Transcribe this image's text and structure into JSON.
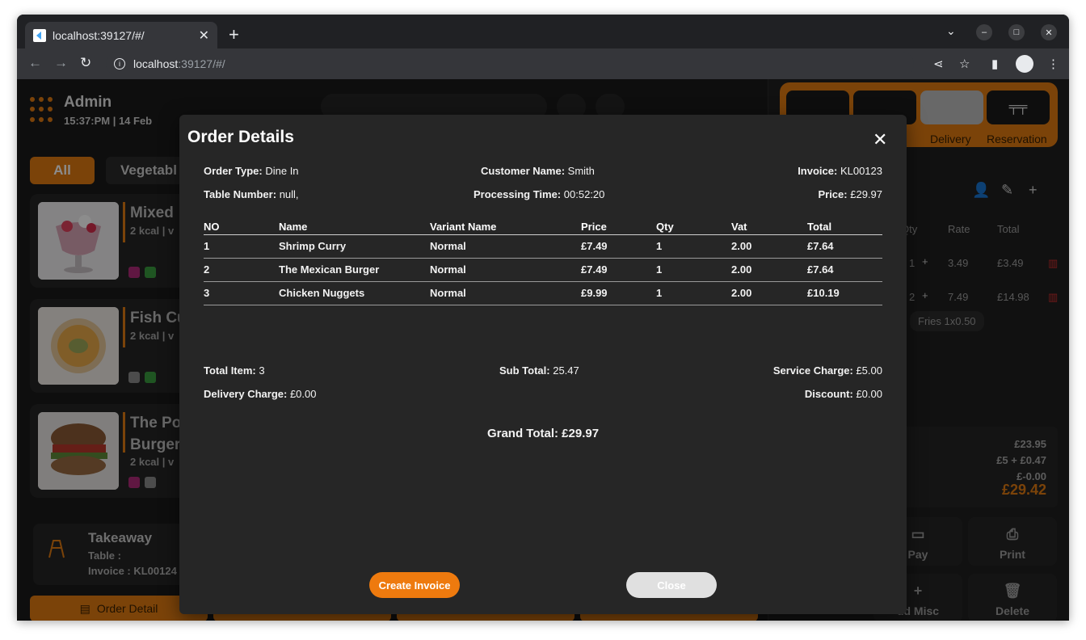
{
  "browser": {
    "tab_title": "localhost:39127/#/",
    "url_host": "localhost",
    "url_rest": ":39127/#/"
  },
  "header": {
    "user_name": "Admin",
    "datetime": "15:37:PM | 14 Feb"
  },
  "categories": [
    "All",
    "Vegetabl"
  ],
  "products": [
    {
      "name": "Mixed",
      "kcal": "2 kcal | v"
    },
    {
      "name": "Fish Cu",
      "kcal": "2 kcal | v"
    },
    {
      "name": "The Po\nBurger",
      "kcal": "2 kcal | v"
    }
  ],
  "takeaway": {
    "title": "Takeaway",
    "table": "Table :",
    "invoice": "Invoice : KL00124"
  },
  "left_footer": {
    "order_detail": "Order Detail"
  },
  "right_panel": {
    "order_types": [
      "Delivery",
      "Reservation"
    ],
    "columns": [
      "Qty",
      "Rate",
      "Total"
    ],
    "rows": [
      {
        "qty": "1",
        "rate": "3.49",
        "total": "£3.49"
      },
      {
        "qty": "2",
        "rate": "7.49",
        "total": "£14.98"
      }
    ],
    "chip": "Fries  1x0.50",
    "totals": [
      "£23.95",
      "£5 + £0.47",
      "£-0.00"
    ],
    "grand": "£29.42",
    "buttons": [
      "Pay",
      "Print",
      "dd Misc",
      "Delete"
    ]
  },
  "modal": {
    "title": "Order Details",
    "order_type_label": "Order Type:",
    "order_type": "Dine In",
    "customer_label": "Customer Name:",
    "customer": "Smith",
    "invoice_label": "Invoice:",
    "invoice": "KL00123",
    "table_label": "Table Number:",
    "table": "null,",
    "processing_label": "Processing Time:",
    "processing": "00:52:20",
    "price_label": "Price:",
    "price": "£29.97",
    "columns": [
      "NO",
      "Name",
      "Variant Name",
      "Price",
      "Qty",
      "Vat",
      "Total"
    ],
    "items": [
      {
        "no": "1",
        "name": "Shrimp Curry",
        "variant": "Normal",
        "price": "£7.49",
        "qty": "1",
        "vat": "2.00",
        "total": "£7.64"
      },
      {
        "no": "2",
        "name": "The Mexican Burger",
        "variant": "Normal",
        "price": "£7.49",
        "qty": "1",
        "vat": "2.00",
        "total": "£7.64"
      },
      {
        "no": "3",
        "name": "Chicken Nuggets",
        "variant": "Normal",
        "price": "£9.99",
        "qty": "1",
        "vat": "2.00",
        "total": "£10.19"
      }
    ],
    "total_item_label": "Total Item:",
    "total_item": "3",
    "sub_total_label": "Sub Total:",
    "sub_total": "25.47",
    "service_label": "Service Charge:",
    "service": "£5.00",
    "delivery_label": "Delivery Charge:",
    "delivery": "£0.00",
    "discount_label": "Discount:",
    "discount": "£0.00",
    "grand_label": "Grand Total:",
    "grand": "£29.97",
    "create_invoice": "Create Invoice",
    "close": "Close"
  },
  "colors": {
    "accent": "#ee7a0e",
    "modal_bg": "#262626",
    "page_bg": "#1b1b1b"
  }
}
